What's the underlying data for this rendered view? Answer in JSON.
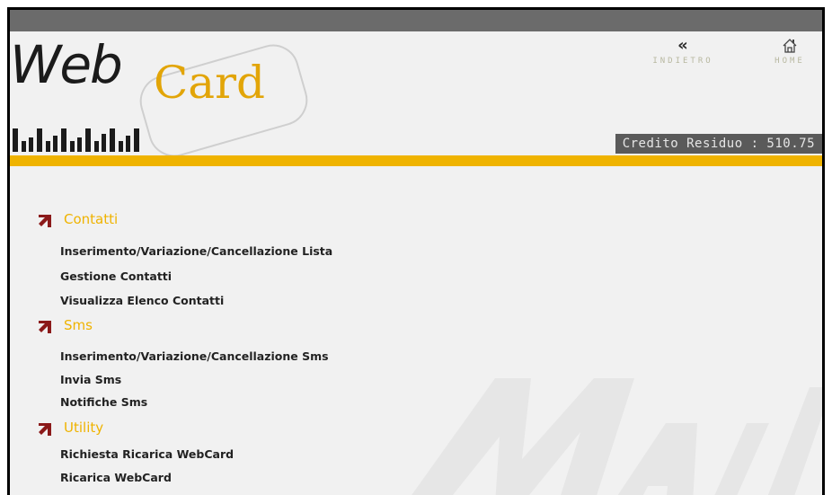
{
  "brand": {
    "logo_word_1": "Web",
    "logo_word_2": "Card"
  },
  "nav": {
    "back_label": "INDIETRO",
    "home_label": "HOME"
  },
  "credit": {
    "text": "Credito Residuo : 510.75"
  },
  "sections": [
    {
      "title": "Contatti",
      "items": [
        "Inserimento/Variazione/Cancellazione Lista",
        "Gestione Contatti",
        "Visualizza Elenco Contatti"
      ]
    },
    {
      "title": "Sms",
      "items": [
        "Inserimento/Variazione/Cancellazione Sms",
        "Invia Sms",
        "Notifiche Sms"
      ]
    },
    {
      "title": "Utility",
      "items": [
        "Richiesta Ricarica WebCard",
        "Ricarica WebCard"
      ]
    }
  ],
  "colors": {
    "accent": "#efb300",
    "arrow": "#8b1a1a",
    "topbar": "#6b6b6b",
    "credit_bg": "#5a5a5a"
  }
}
